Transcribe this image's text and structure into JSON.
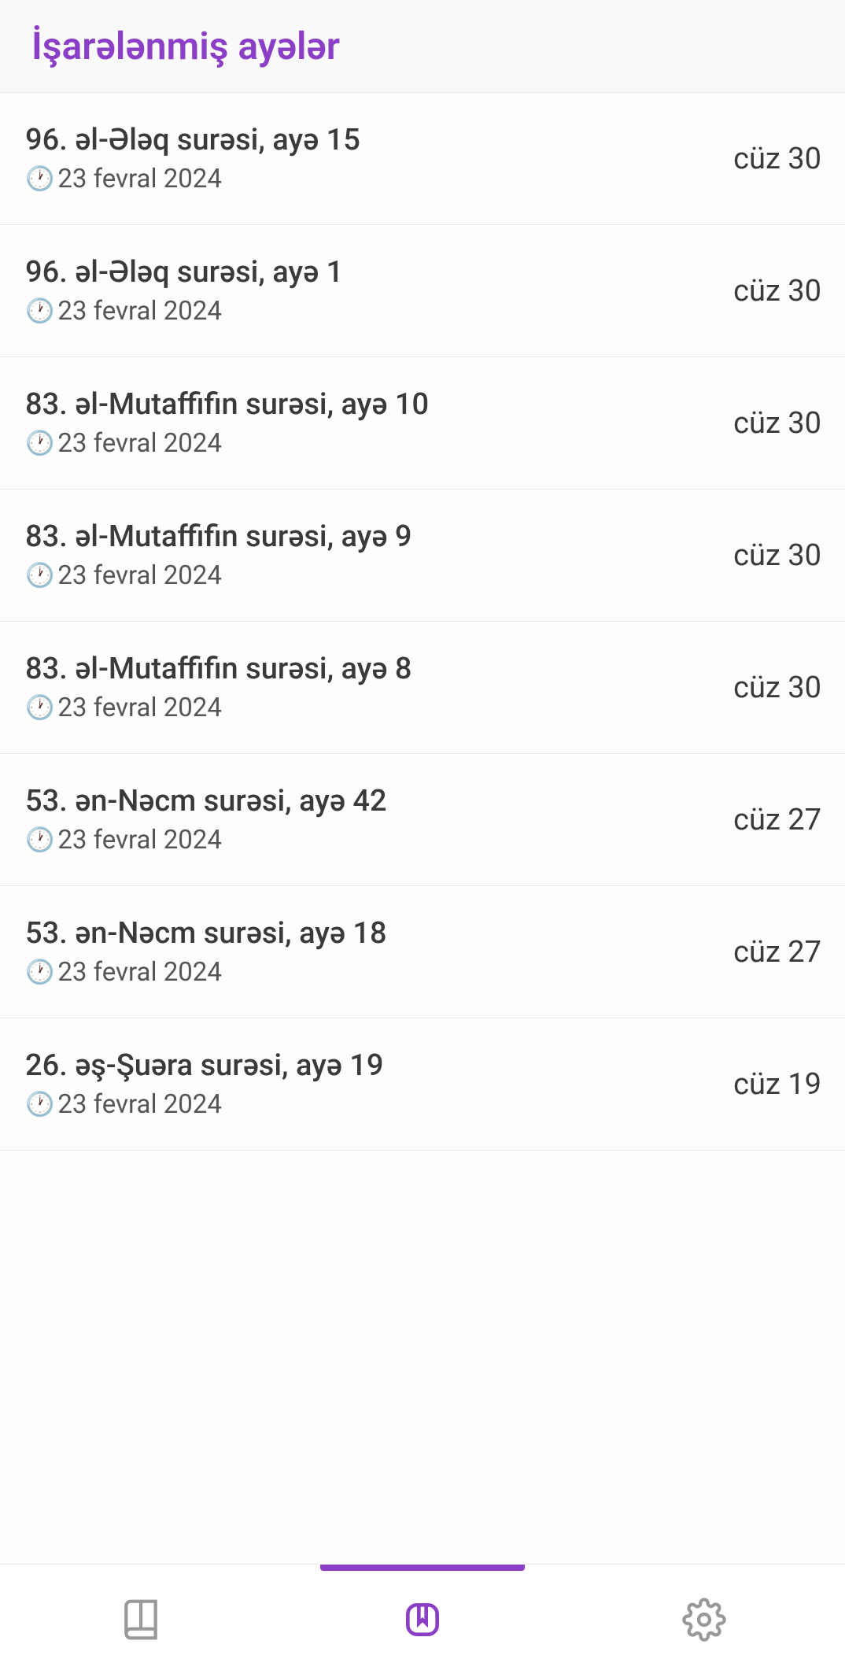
{
  "header": {
    "title": "İşarələnmiş ayələr"
  },
  "bookmarks": [
    {
      "title": "96. əl-Ələq surəsi, ayə 15",
      "date": "23 fevral 2024",
      "juz": "cüz 30"
    },
    {
      "title": "96. əl-Ələq surəsi, ayə 1",
      "date": "23 fevral 2024",
      "juz": "cüz 30"
    },
    {
      "title": "83. əl-Mutaffifin surəsi, ayə 10",
      "date": "23 fevral 2024",
      "juz": "cüz 30"
    },
    {
      "title": "83. əl-Mutaffifin surəsi, ayə 9",
      "date": "23 fevral 2024",
      "juz": "cüz 30"
    },
    {
      "title": "83. əl-Mutaffifin surəsi, ayə 8",
      "date": "23 fevral 2024",
      "juz": "cüz 30"
    },
    {
      "title": "53. ən-Nəcm surəsi, ayə 42",
      "date": "23 fevral 2024",
      "juz": "cüz 27"
    },
    {
      "title": "53. ən-Nəcm surəsi, ayə 18",
      "date": "23 fevral 2024",
      "juz": "cüz 27"
    },
    {
      "title": "26. əş-Şuəra surəsi, ayə 19",
      "date": "23 fevral 2024",
      "juz": "cüz 19"
    }
  ],
  "icons": {
    "clock": "🕐"
  }
}
